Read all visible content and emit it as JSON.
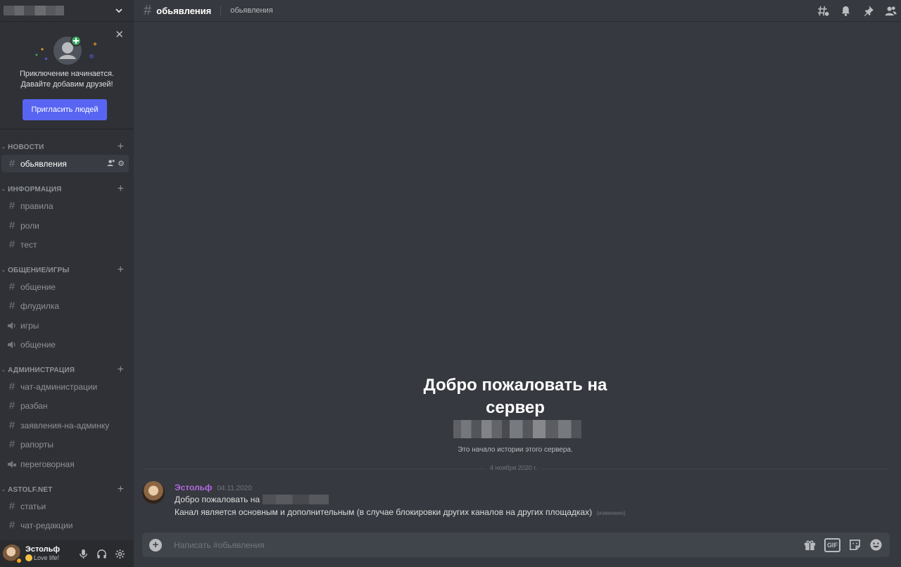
{
  "sidebar": {
    "invite": {
      "line1": "Приключение начинается.",
      "line2": "Давайте добавим друзей!",
      "button": "Пригласить людей"
    },
    "categories": [
      {
        "label": "НОВОСТИ",
        "channels": [
          {
            "name": "обьявления",
            "type": "text",
            "active": true
          }
        ]
      },
      {
        "label": "ИНФОРМАЦИЯ",
        "channels": [
          {
            "name": "правила",
            "type": "text"
          },
          {
            "name": "роли",
            "type": "text"
          },
          {
            "name": "тест",
            "type": "text"
          }
        ]
      },
      {
        "label": "ОБЩЕНИЕ/ИГРЫ",
        "channels": [
          {
            "name": "общение",
            "type": "text"
          },
          {
            "name": "флудилка",
            "type": "text"
          },
          {
            "name": "игры",
            "type": "voice"
          },
          {
            "name": "общение",
            "type": "voice"
          }
        ]
      },
      {
        "label": "АДМИНИСТРАЦИЯ",
        "channels": [
          {
            "name": "чат-администрации",
            "type": "text"
          },
          {
            "name": "разбан",
            "type": "text"
          },
          {
            "name": "заявления-на-админку",
            "type": "text"
          },
          {
            "name": "рапорты",
            "type": "text"
          },
          {
            "name": "переговорная",
            "type": "voice"
          }
        ]
      },
      {
        "label": "ASTOLF.NET",
        "channels": [
          {
            "name": "статьи",
            "type": "text"
          },
          {
            "name": "чат-редакции",
            "type": "text"
          }
        ]
      }
    ]
  },
  "user": {
    "name": "Эстольф",
    "status": "Love life!",
    "status_color": "#faa61a"
  },
  "topbar": {
    "channel": "обьявления",
    "topic": "обьявления"
  },
  "welcome": {
    "title_line1": "Добро пожаловать на",
    "title_line2": "сервер",
    "subtitle": "Это начало истории этого сервера."
  },
  "divider": {
    "date": "4 ноября 2020 г."
  },
  "message": {
    "author": "Эстольф",
    "author_color": "#b36ae0",
    "timestamp": "04.11.2020",
    "line1": "Добро пожаловать на",
    "line2": "Канал является  основным и дополнительным (в случае блокировки других каналов на других площадках)",
    "edited": "(изменено)"
  },
  "composer": {
    "placeholder": "Написать #обьявления",
    "gif_label": "GIF"
  },
  "colors": {
    "accent": "#5865f2",
    "bg": "#36393f",
    "sidebar": "#2f3136"
  }
}
